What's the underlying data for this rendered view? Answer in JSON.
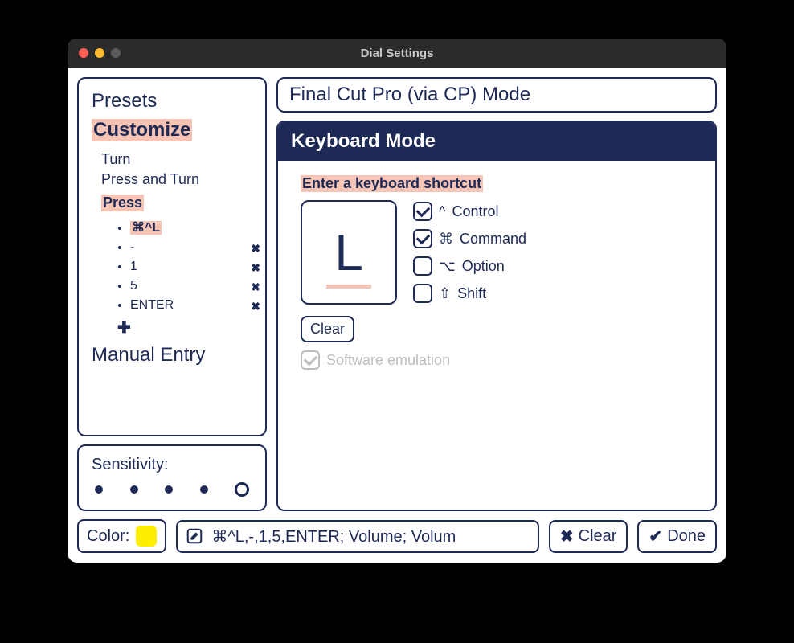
{
  "window": {
    "title": "Dial Settings"
  },
  "sidebar": {
    "presets_label": "Presets",
    "customize_label": "Customize",
    "items": {
      "turn": "Turn",
      "press_and_turn": "Press and Turn",
      "press": "Press"
    },
    "press_actions": [
      {
        "label": "⌘^L",
        "removable": false,
        "selected": true
      },
      {
        "label": "-",
        "removable": true,
        "selected": false
      },
      {
        "label": "1",
        "removable": true,
        "selected": false
      },
      {
        "label": "5",
        "removable": true,
        "selected": false
      },
      {
        "label": "ENTER",
        "removable": true,
        "selected": false
      }
    ],
    "manual_entry_label": "Manual Entry"
  },
  "sensitivity": {
    "label": "Sensitivity:",
    "levels": 5,
    "selected_index": 4
  },
  "mode": {
    "name": "Final Cut Pro (via CP) Mode"
  },
  "keyboard": {
    "header": "Keyboard Mode",
    "prompt": "Enter a keyboard shortcut",
    "key": "L",
    "modifiers": [
      {
        "symbol": "^",
        "label": "Control",
        "checked": true
      },
      {
        "symbol": "⌘",
        "label": "Command",
        "checked": true
      },
      {
        "symbol": "⌥",
        "label": "Option",
        "checked": false
      },
      {
        "symbol": "⇧",
        "label": "Shift",
        "checked": false
      }
    ],
    "clear_label": "Clear",
    "software_emulation_label": "Software emulation",
    "software_emulation_checked": true
  },
  "footer": {
    "color_label": "Color:",
    "color_value": "#ffee00",
    "name_value": "⌘^L,-,1,5,ENTER; Volume; Volum",
    "clear_label": "Clear",
    "done_label": "Done"
  }
}
